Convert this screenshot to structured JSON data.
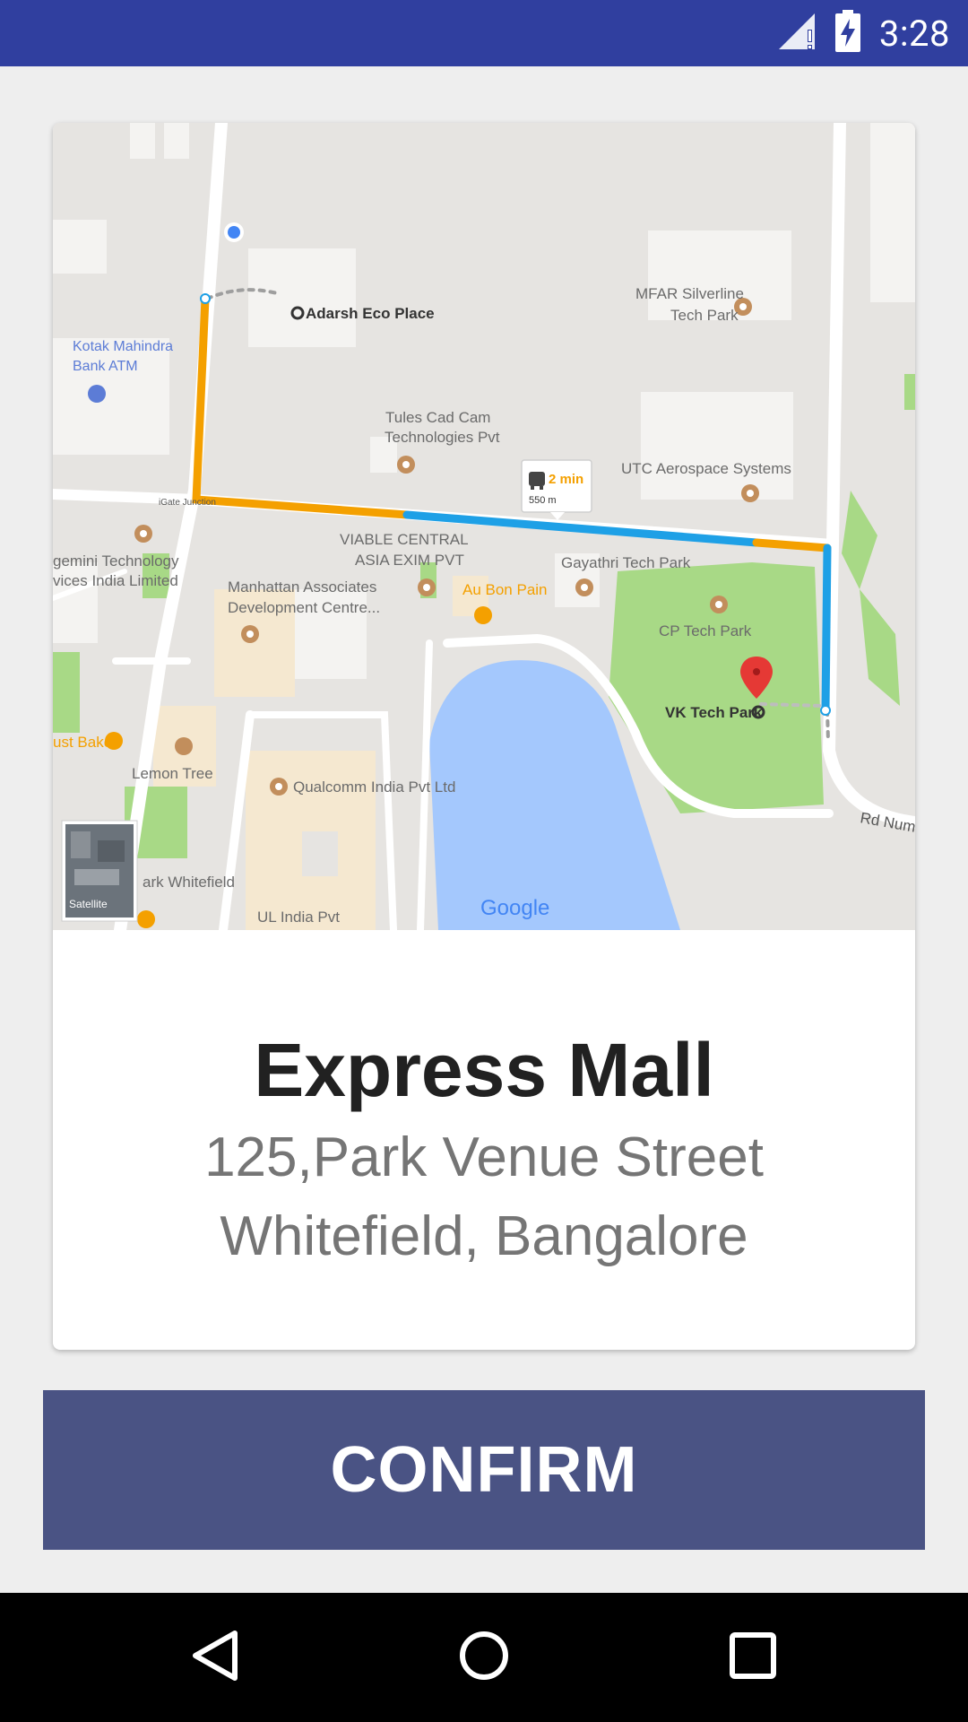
{
  "status_bar": {
    "time": "3:28",
    "bg_color": "#303f9f",
    "icons": [
      "signal-icon",
      "battery-charging-icon"
    ]
  },
  "map": {
    "labels": {
      "adarsh": "Adarsh Eco Place",
      "kotak1": "Kotak Mahindra",
      "kotak2": "Bank ATM",
      "mfar1": "MFAR Silverline",
      "mfar2": "Tech Park",
      "tules1": "Tules Cad Cam",
      "tules2": "Technologies Pvt",
      "utc": "UTC Aerospace Systems",
      "gate": "iGate Junction",
      "gemini1": "gemini Technology",
      "gemini2": "vices India Limited",
      "viable1": "VIABLE CENTRAL",
      "viable2": "ASIA EXIM PVT",
      "gayathri": "Gayathri Tech Park",
      "manhattan1": "Manhattan Associates",
      "manhattan2": "Development Centre...",
      "aubonpain": "Au Bon Pain",
      "cptech": "CP Tech Park",
      "vktech": "VK Tech Park",
      "justbake": "ust Bake",
      "lemontree": "Lemon Tree",
      "qualcomm": "Qualcomm India Pvt Ltd",
      "rdnum": "Rd Num",
      "whitefield": "ark Whitefield",
      "ulindia": "UL India Pvt",
      "satellite": "Satellite",
      "google": "Google"
    },
    "route_bubble": {
      "time": "2 min",
      "distance": "550 m"
    },
    "colors": {
      "route_traffic": "#f4a000",
      "route_clear": "#1ea0e6",
      "water": "#a4c8fd",
      "park": "#a8d986",
      "building": "#f5e8d0",
      "marker": "#e53935"
    }
  },
  "place": {
    "name": "Express Mall",
    "address_line1": "125,Park Venue Street",
    "address_line2": "Whitefield, Bangalore"
  },
  "actions": {
    "confirm_label": "CONFIRM",
    "confirm_color": "#4a5384"
  },
  "nav_bar": {
    "icons": [
      "back-icon",
      "home-icon",
      "recents-icon"
    ]
  }
}
